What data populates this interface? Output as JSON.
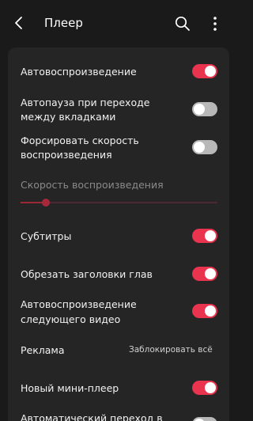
{
  "header": {
    "title": "Плеер"
  },
  "settings": {
    "autoplay": {
      "label": "Автовоспроизведение",
      "on": true
    },
    "autopause": {
      "label_line1": "Автопауза при переходе",
      "label_line2": "между вкладками",
      "on": false
    },
    "force_speed": {
      "label_line1": "Форсировать скорость",
      "label_line2": "воспроизведения",
      "on": false
    },
    "speed": {
      "label": "Скорость воспроизведения",
      "value_fraction": 0.13
    },
    "subtitles": {
      "label": "Субтитры",
      "on": true
    },
    "trim_chapters": {
      "label": "Обрезать заголовки глав",
      "on": true
    },
    "autoplay_next": {
      "label_line1": "Автовоспроизведение",
      "label_line2": "следующего видео",
      "on": true
    },
    "ads": {
      "label": "Реклама",
      "value": "Заблокировать всё"
    },
    "mini_player": {
      "label": "Новый мини-плеер",
      "on": true
    },
    "auto_switch": {
      "label_line1": "Автоматический переход в",
      "on": false
    }
  },
  "colors": {
    "accent": "#e8344e",
    "toggle_off": "#b8b8b8",
    "background": "#1a1a1a",
    "card": "#252525"
  }
}
